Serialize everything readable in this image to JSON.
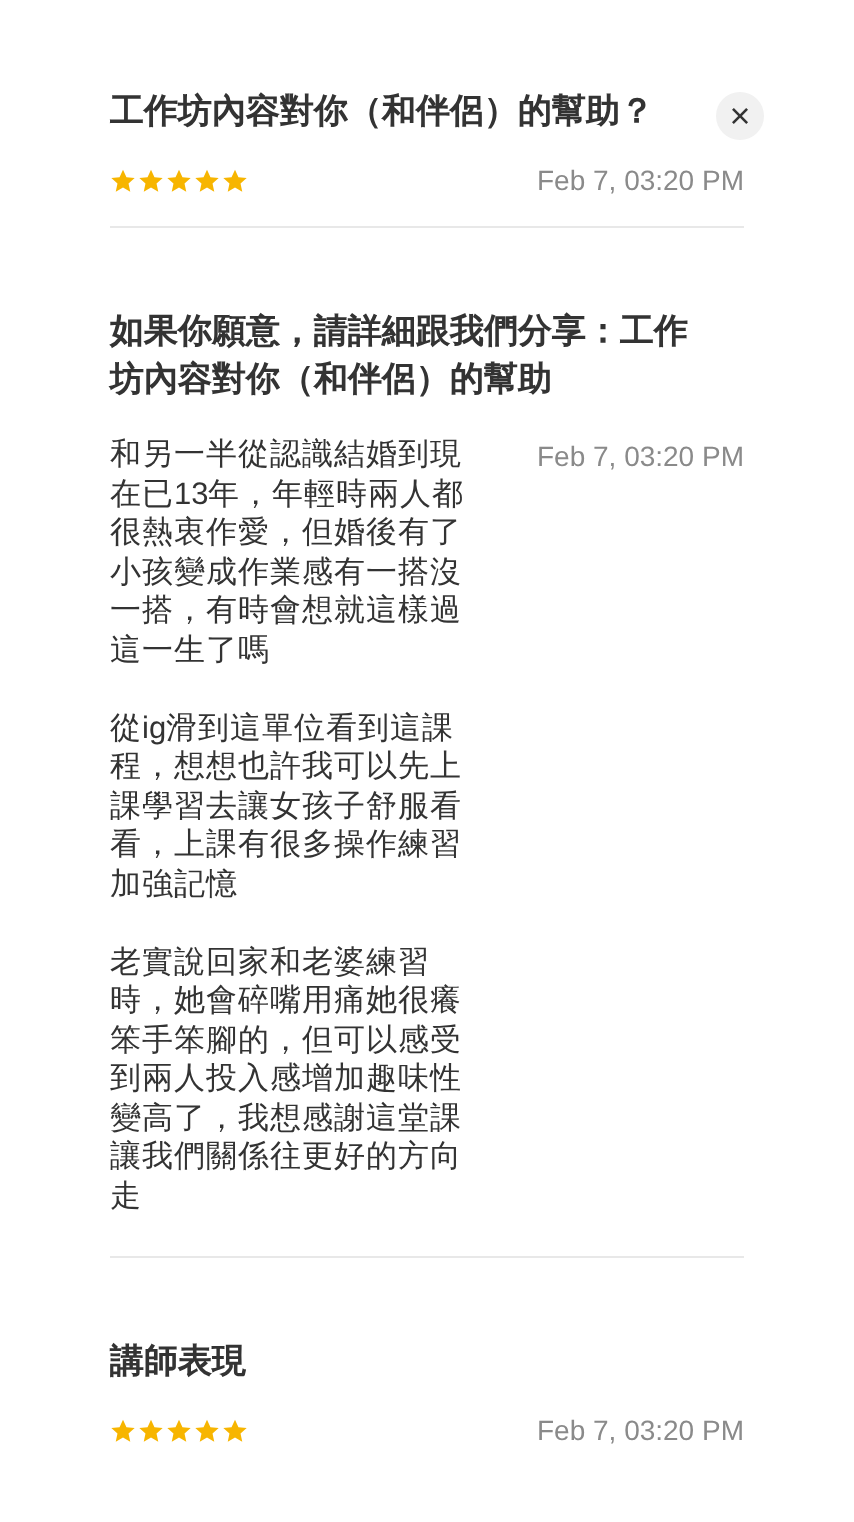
{
  "close_button": {
    "label": "×"
  },
  "questions": [
    {
      "kind": "rating",
      "title": "工作坊內容對你（和伴侶）的幫助？",
      "stars": 5,
      "date": "Feb 7, 03:20 PM"
    },
    {
      "kind": "text",
      "title": "如果你願意，請詳細跟我們分享：工作坊內容對你（和伴侶）的幫助",
      "answer": [
        "和另一半從認識結婚到現在已13年，年輕時兩人都很熱衷作愛，但婚後有了小孩變成作業感有一搭沒一搭，有時會想就這樣過這一生了嗎",
        "從ig滑到這單位看到這課程，想想也許我可以先上課學習去讓女孩子舒服看看，上課有很多操作練習加強記憶",
        "老實說回家和老婆練習時，她會碎嘴用痛她很癢笨手笨腳的，但可以感受到兩人投入感增加趣味性變高了，我想感謝這堂課讓我們關係往更好的方向走"
      ],
      "date": "Feb 7, 03:20 PM"
    },
    {
      "kind": "rating",
      "title": "講師表現",
      "stars": 5,
      "date": "Feb 7, 03:20 PM"
    }
  ]
}
